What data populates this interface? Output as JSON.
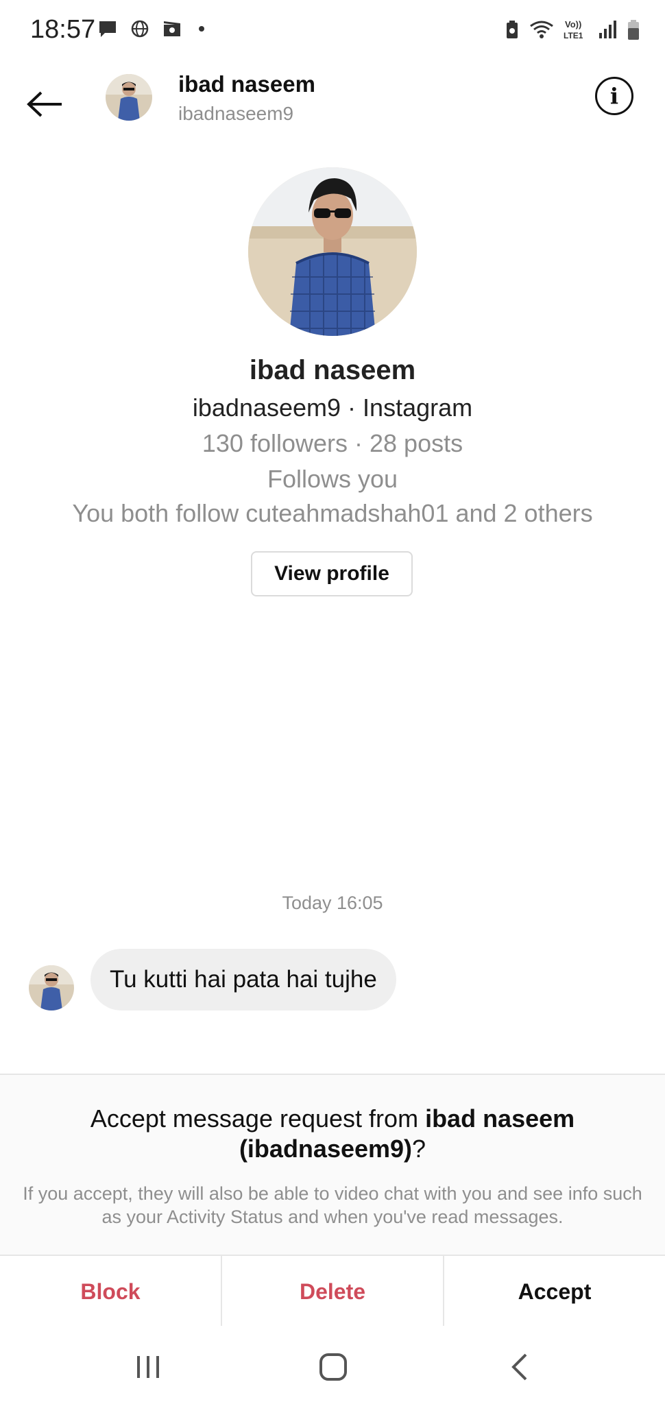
{
  "status_bar": {
    "time": "18:57",
    "network": "VoLTE1"
  },
  "header": {
    "name": "ibad naseem",
    "username": "ibadnaseem9"
  },
  "profile": {
    "name": "ibad naseem",
    "subtitle": "ibadnaseem9 · Instagram",
    "stats": "130 followers · 28 posts",
    "follows": "Follows you",
    "mutual": "You both follow cuteahmadshah01 and 2 others",
    "view_profile_label": "View profile"
  },
  "conversation": {
    "timestamp": "Today 16:05",
    "message": "Tu kutti hai pata hai tujhe"
  },
  "request": {
    "title_prefix": "Accept message request from ",
    "title_bold": "ibad naseem (ibadnaseem9)",
    "title_suffix": "?",
    "description": "If you accept, they will also be able to video chat with you and see info such as your Activity Status and when you've read messages."
  },
  "actions": {
    "block": "Block",
    "delete": "Delete",
    "accept": "Accept"
  },
  "colors": {
    "danger": "#cf4b5a",
    "muted": "#8e8e8e",
    "bubble": "#efefef"
  }
}
